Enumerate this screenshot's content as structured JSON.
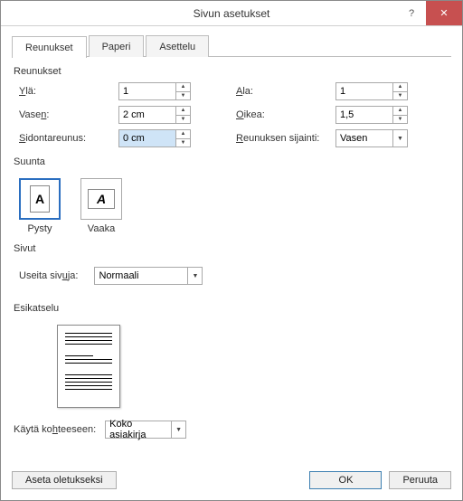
{
  "window": {
    "title": "Sivun asetukset",
    "help": "?",
    "close": "✕"
  },
  "tabs": {
    "margins": "Reunukset",
    "paper": "Paperi",
    "layout": "Asettelu"
  },
  "groups": {
    "margins": "Reunukset",
    "orientation": "Suunta",
    "pages": "Sivut",
    "preview": "Esikatselu"
  },
  "margin": {
    "top_label_pre": "",
    "top_ul": "Y",
    "top_label_post": "lä:",
    "top_val": "1",
    "bottom_ul": "A",
    "bottom_label_post": "la:",
    "bottom_val": "1",
    "left_label_pre": "Vase",
    "left_ul": "n",
    "left_label_post": ":",
    "left_val": "2 cm",
    "right_ul": "O",
    "right_label_post": "ikea:",
    "right_val": "1,5",
    "gutter_ul": "S",
    "gutter_label_post": "idontareunus:",
    "gutter_val": "0 cm",
    "gutterpos_ul": "R",
    "gutterpos_label_post": "eunuksen sijainti:",
    "gutterpos_val": "Vasen"
  },
  "orientation": {
    "portrait_pre": "P",
    "portrait_ul": "y",
    "portrait_post": "sty",
    "landscape_ul": "V",
    "landscape_post": "aaka"
  },
  "pages": {
    "label_pre": "Useita siv",
    "label_ul": "u",
    "label_post": "ja:",
    "value": "Normaali"
  },
  "apply": {
    "label_pre": "Käytä ko",
    "label_ul": "h",
    "label_post": "teeseen:",
    "value": "Koko asiakirja"
  },
  "footer": {
    "default": "Aseta oletukseksi",
    "ok": "OK",
    "cancel": "Peruuta"
  }
}
